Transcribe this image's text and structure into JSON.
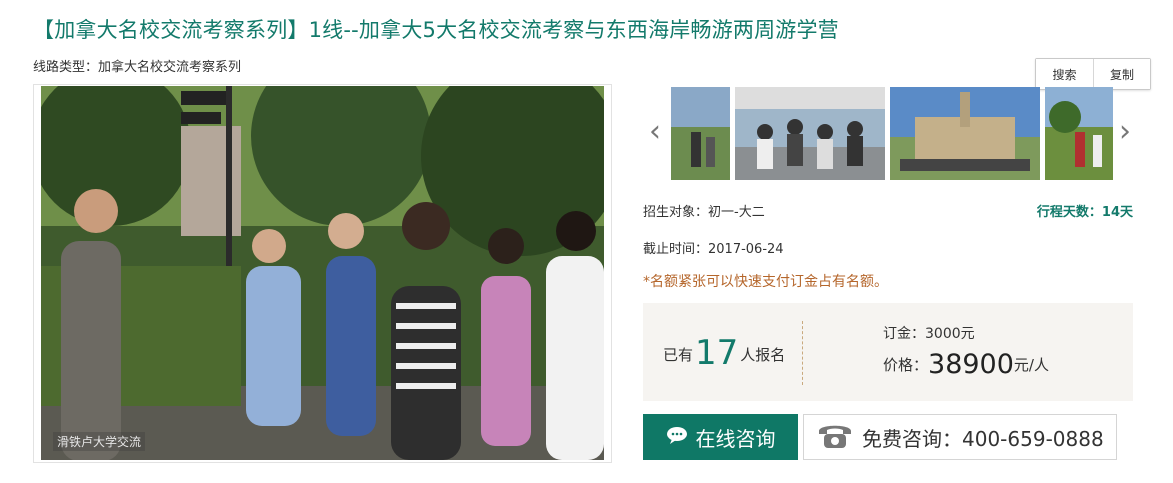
{
  "page": {
    "title": "【加拿大名校交流考察系列】1线--加拿大5大名校交流考察与东西海岸畅游两周游学营",
    "route_type": "线路类型：加拿大名校交流考察系列"
  },
  "toolbar": {
    "search_label": "搜索",
    "copy_label": "复制"
  },
  "main_photo": {
    "caption": "滑铁卢大学交流"
  },
  "info": {
    "target": "招生对象：初一-大二",
    "days": "行程天数：14天",
    "deadline": "截止时间：2017-06-24",
    "notice": "*名额紧张可以快速支付订金占有名额。"
  },
  "booking": {
    "enrolled_prefix": "已有",
    "enrolled_count": "17",
    "enrolled_suffix": "人报名",
    "deposit": "订金：3000元",
    "price_label": "价格：",
    "price_value": "38900",
    "price_unit": "元/人"
  },
  "buttons": {
    "online_consult": "在线咨询",
    "free_consult": "免费咨询：400-659-0888"
  },
  "colors": {
    "accent": "#0f7866",
    "title": "#137a6b",
    "notice": "#b5662b"
  }
}
